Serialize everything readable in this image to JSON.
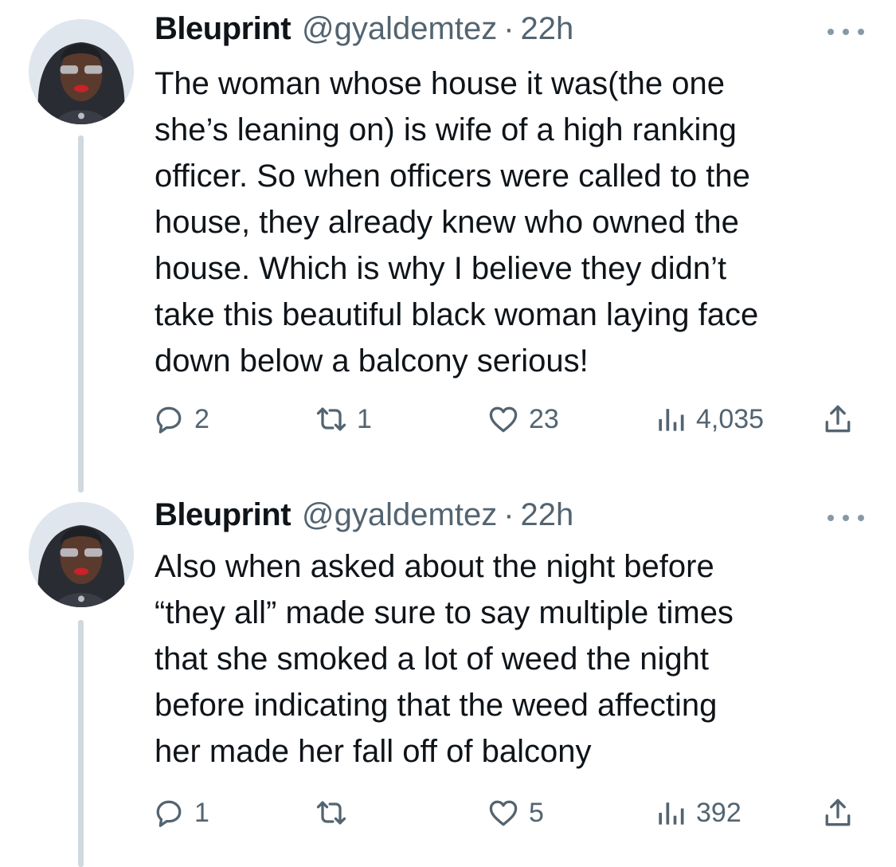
{
  "tweets": [
    {
      "author_name": "Bleuprint",
      "handle": "@gyaldemtez",
      "separator": "·",
      "time": "22h",
      "text_lines": [
        "The woman whose house it was(the one",
        "she’s leaning on) is wife of a high ranking",
        "officer. So when officers were called to the",
        "house, they already knew who owned the",
        "house. Which is why I believe they didn’t",
        "take this beautiful black woman laying face",
        "down below a balcony serious!"
      ],
      "replies": "2",
      "retweets": "1",
      "likes": "23",
      "views": "4,035"
    },
    {
      "author_name": "Bleuprint",
      "handle": "@gyaldemtez",
      "separator": "·",
      "time": "22h",
      "text_lines": [
        "Also when asked about the night before",
        "“they all” made sure to say multiple times",
        "that she smoked a lot of weed the night",
        "before indicating that the weed affecting",
        "her made her fall off of balcony"
      ],
      "replies": "1",
      "retweets": "",
      "likes": "5",
      "views": "392"
    }
  ],
  "icons": {
    "reply": "reply-icon",
    "retweet": "retweet-icon",
    "like": "heart-icon",
    "views": "views-bar-chart-icon",
    "share": "share-icon",
    "more": "more-options-icon"
  },
  "colors": {
    "text": "#0f1419",
    "secondary": "#536471",
    "thread_line": "#cfd9de"
  }
}
